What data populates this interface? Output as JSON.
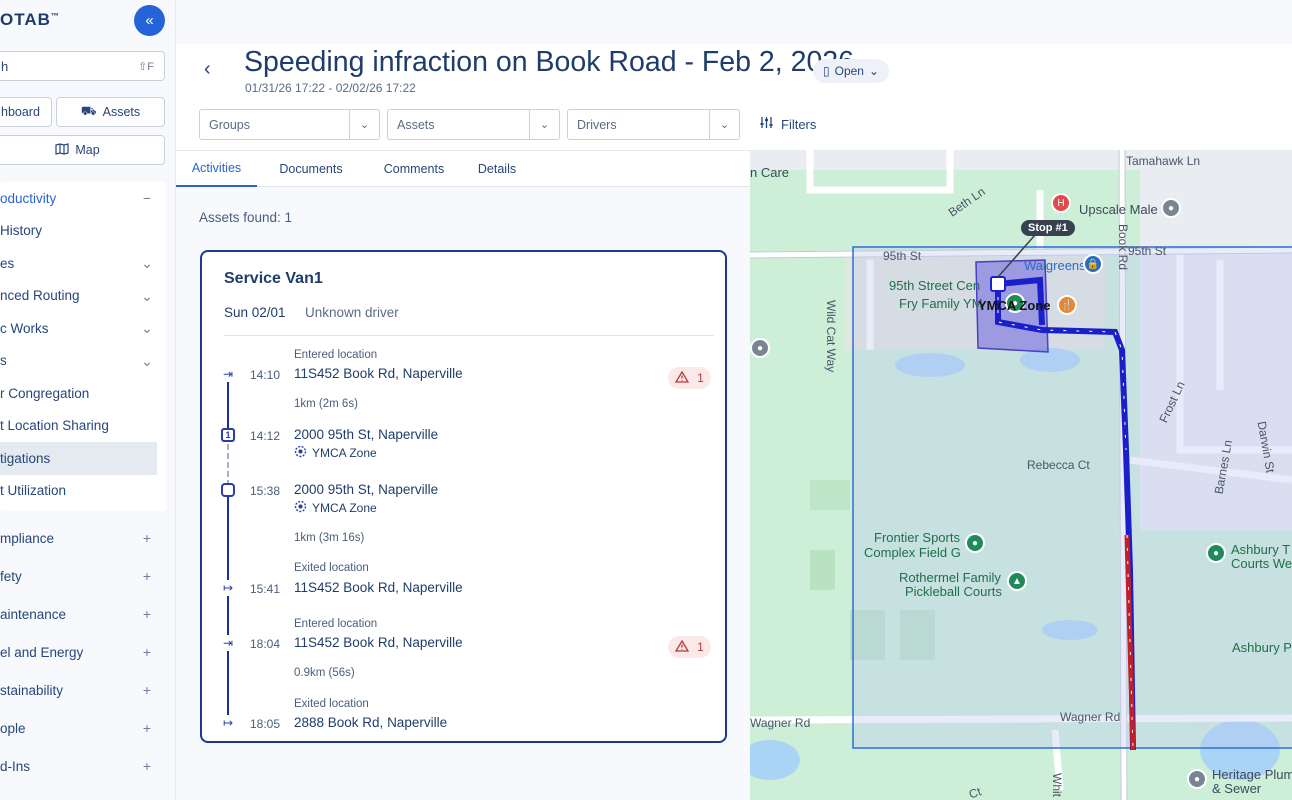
{
  "sidebar": {
    "logo": "OTAB",
    "logo_suffix": "™",
    "search": {
      "value": "h",
      "shortcut": "⇧F"
    },
    "buttons": {
      "dashboard": "hboard",
      "assets": "Assets",
      "map": "Map"
    },
    "items": [
      {
        "label": "oductivity",
        "type": "section-open",
        "control": "−"
      },
      {
        "label": " History",
        "type": "item"
      },
      {
        "label": "es",
        "type": "expandable",
        "control": "⌄"
      },
      {
        "label": "nced Routing",
        "type": "expandable",
        "control": "⌄"
      },
      {
        "label": "c Works",
        "type": "expandable",
        "control": "⌄"
      },
      {
        "label": "s",
        "type": "expandable",
        "control": "⌄"
      },
      {
        "label": "r Congregation",
        "type": "item"
      },
      {
        "label": "t Location Sharing",
        "type": "item"
      },
      {
        "label": "tigations",
        "type": "selected"
      },
      {
        "label": "t Utilization",
        "type": "item"
      },
      {
        "label": "mpliance",
        "type": "section",
        "control": "+"
      },
      {
        "label": "fety",
        "type": "section",
        "control": "+"
      },
      {
        "label": "aintenance",
        "type": "section",
        "control": "+"
      },
      {
        "label": "el and Energy",
        "type": "section",
        "control": "+"
      },
      {
        "label": "stainability",
        "type": "section",
        "control": "+"
      },
      {
        "label": "ople",
        "type": "section",
        "control": "+"
      },
      {
        "label": "d-Ins",
        "type": "section",
        "control": "+"
      }
    ]
  },
  "header": {
    "title": "Speeding infraction on Book Road - Feb 2, 2026",
    "date_range": "01/31/26 17:22 - 02/02/26 17:22",
    "status": "Open",
    "filters": {
      "groups": "Groups",
      "assets": "Assets",
      "drivers": "Drivers",
      "filters_label": "Filters"
    }
  },
  "tabs": [
    "Activities",
    "Documents",
    "Comments",
    "Details"
  ],
  "assets_found": "Assets found: 1",
  "card": {
    "title": "Service Van1",
    "day": "Sun 02/01",
    "driver": "Unknown driver",
    "events": [
      {
        "small": "Entered location",
        "time": "14:10",
        "address": "11S452 Book Rd, Naperville",
        "warnings": "1"
      },
      {
        "distance": "1km (2m 6s)"
      },
      {
        "time": "14:12",
        "stop": "1",
        "address": "2000 95th St, Naperville",
        "zone": "YMCA Zone"
      },
      {
        "time": "15:38",
        "address": "2000 95th St, Naperville",
        "zone": "YMCA Zone"
      },
      {
        "distance": "1km (3m 16s)"
      },
      {
        "small": "Exited location",
        "time": "15:41",
        "address": "11S452 Book Rd, Naperville"
      },
      {
        "small": "Entered location",
        "time": "18:04",
        "address": "11S452 Book Rd, Naperville",
        "warnings": "1"
      },
      {
        "distance": "0.9km (56s)"
      },
      {
        "small": "Exited location",
        "time": "18:05",
        "address": "2888 Book Rd, Naperville"
      }
    ]
  },
  "map": {
    "labels": {
      "tamahawk": "Tamahawk Ln",
      "care": "n Care",
      "beth": "Beth Ln",
      "upscale": "Upscale Male",
      "st95_left": "95th St",
      "st95_right": "95th St",
      "book_rd": "Book Rd",
      "walgreens": "Walgreens",
      "street_center": "95th Street Cen",
      "fry": "Fry Family YM",
      "wildcat": "Wild Cat Way",
      "frost": "Frost Ln",
      "rebecca": "Rebecca Ct",
      "barnes": "Barnes Ln",
      "darwin": "Darwin St",
      "frontier": "Frontier Sports",
      "complex": "Complex Field G",
      "rothermel": "Rothermel Family",
      "pickleball": "Pickleball Courts",
      "ashbury_t": "Ashbury T",
      "courts_we": "Courts We",
      "ashbury_park": "Ashbury Park",
      "wagner_left": "Wagner Rd",
      "wagner_right": "Wagner Rd",
      "heritage": "Heritage Plum",
      "sewer": "& Sewer",
      "whit": "Whit",
      "ct": "Ct"
    },
    "stop_tag": "Stop #1",
    "zone_label": "YMCA Zone"
  },
  "colors": {
    "accent": "#2564d8",
    "route": "#1b1fc9",
    "speeding": "#c0202a",
    "park": "#c8ead3"
  }
}
